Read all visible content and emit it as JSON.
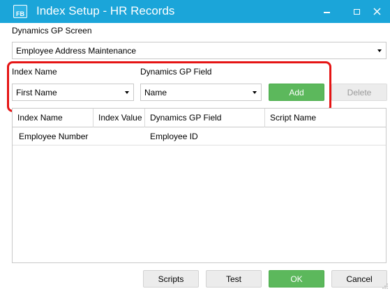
{
  "window": {
    "title": "Index Setup - HR Records",
    "app_icon": "FB"
  },
  "screen": {
    "label": "Dynamics GP Screen",
    "selected": "Employee Address Maintenance"
  },
  "index_name": {
    "label": "Index Name",
    "selected": "First Name"
  },
  "gp_field": {
    "label": "Dynamics GP Field",
    "selected": "Name"
  },
  "buttons": {
    "add": "Add",
    "delete": "Delete",
    "scripts": "Scripts",
    "test": "Test",
    "ok": "OK",
    "cancel": "Cancel"
  },
  "table": {
    "columns": [
      "Index Name",
      "Index Value",
      "Dynamics GP Field",
      "Script Name"
    ],
    "rows": [
      {
        "index_name": "Employee Number",
        "index_value": "",
        "gp_field": "Employee ID",
        "script_name": ""
      }
    ]
  },
  "colors": {
    "titlebar": "#1ba5d9",
    "accent_green": "#5cb85c",
    "highlight_red": "#e51414"
  },
  "icons": {
    "minimize": "minimize-icon",
    "maximize": "maximize-icon",
    "close": "close-icon",
    "dropdown": "chevron-down-icon"
  }
}
